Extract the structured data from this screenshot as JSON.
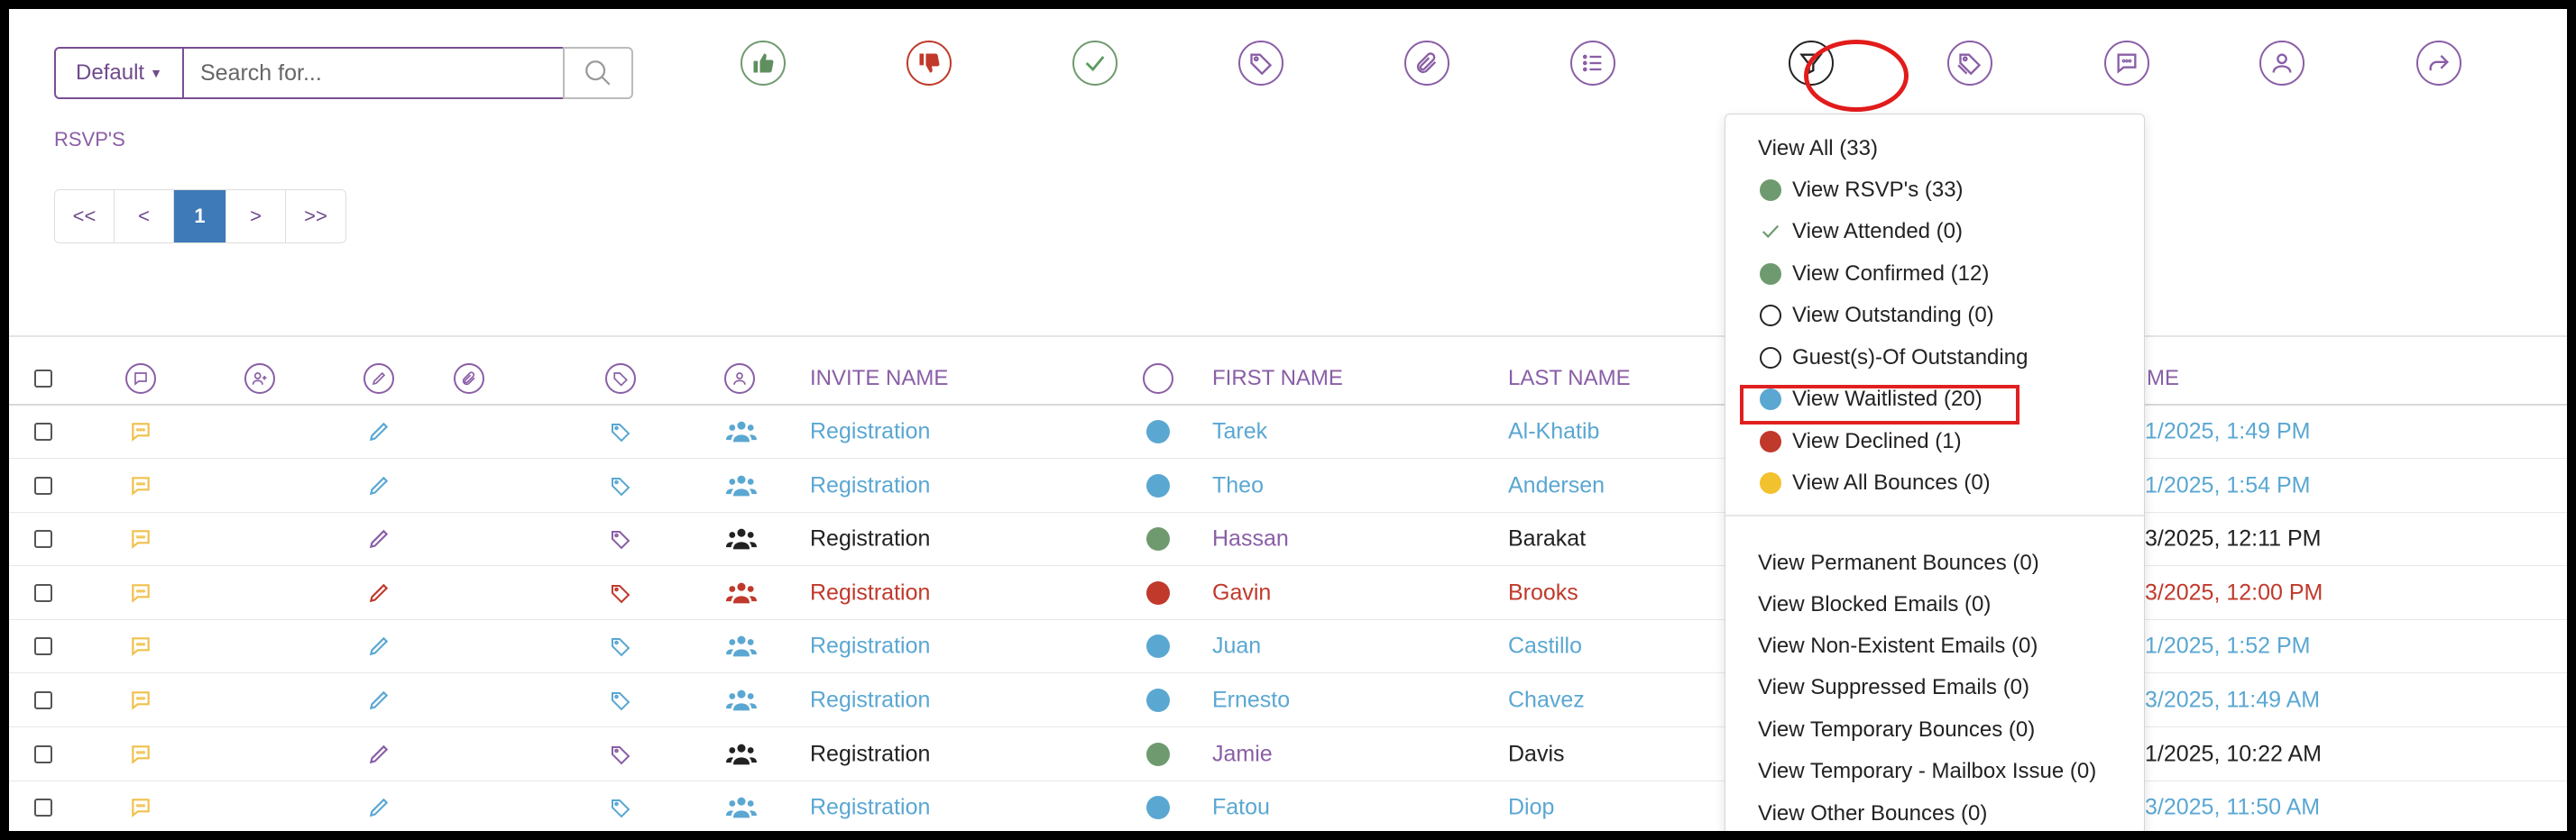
{
  "toolbar": {
    "default_label": "Default",
    "search_placeholder": "Search for...",
    "icons": [
      "thumbs-up-icon",
      "thumbs-down-icon",
      "check-icon",
      "tag-icon",
      "paperclip-icon",
      "list-icon",
      "filter-icon",
      "tags-icon",
      "message-icon",
      "user-icon",
      "share-icon"
    ]
  },
  "section_label": "RSVP'S",
  "pager": {
    "first": "<<",
    "prev": "<",
    "current": "1",
    "next": ">",
    "last": ">>"
  },
  "table": {
    "headers": {
      "invite_name": "INVITE NAME",
      "first_name": "FIRST NAME",
      "last_name": "LAST NAME",
      "time_partial": "ME"
    },
    "rows": [
      {
        "invite": "Registration",
        "first": "Tarek",
        "last": "Al-Khatib",
        "time": "1/2025, 1:49 PM",
        "status": "waitlisted"
      },
      {
        "invite": "Registration",
        "first": "Theo",
        "last": "Andersen",
        "time": "1/2025, 1:54 PM",
        "status": "waitlisted"
      },
      {
        "invite": "Registration",
        "first": "Hassan",
        "last": "Barakat",
        "time": "3/2025, 12:11 PM",
        "status": "confirmed"
      },
      {
        "invite": "Registration",
        "first": "Gavin",
        "last": "Brooks",
        "time": "3/2025, 12:00 PM",
        "status": "declined"
      },
      {
        "invite": "Registration",
        "first": "Juan",
        "last": "Castillo",
        "time": "1/2025, 1:52 PM",
        "status": "waitlisted"
      },
      {
        "invite": "Registration",
        "first": "Ernesto",
        "last": "Chavez",
        "time": "3/2025, 11:49 AM",
        "status": "waitlisted"
      },
      {
        "invite": "Registration",
        "first": "Jamie",
        "last": "Davis",
        "time": "1/2025, 10:22 AM",
        "status": "confirmed"
      },
      {
        "invite": "Registration",
        "first": "Fatou",
        "last": "Diop",
        "time": "3/2025, 11:50 AM",
        "status": "waitlisted"
      }
    ]
  },
  "colors": {
    "purple": "#8a5ea6",
    "waitlisted": "#5aa7d2",
    "confirmed": "#6f9a6f",
    "declined": "#c0392b",
    "bounce": "#f2c12e",
    "note": "#f0c04a",
    "accent_ring": "#e21b1b"
  },
  "filter_menu": {
    "items": [
      {
        "label": "View All (33)",
        "marker": "none"
      },
      {
        "label": "View RSVP's (33)",
        "marker": "green-dot"
      },
      {
        "label": "View Attended (0)",
        "marker": "check"
      },
      {
        "label": "View Confirmed (12)",
        "marker": "green-dot"
      },
      {
        "label": "View Outstanding (0)",
        "marker": "hollow"
      },
      {
        "label": "Guest(s)-Of Outstanding",
        "marker": "hollow"
      },
      {
        "label": "View Waitlisted (20)",
        "marker": "blue-dot"
      },
      {
        "label": "View Declined (1)",
        "marker": "red-dot"
      },
      {
        "label": "View All Bounces (0)",
        "marker": "yellow-dot"
      },
      {
        "label": "View Permanent Bounces (0)",
        "marker": "none"
      },
      {
        "label": "View Blocked Emails (0)",
        "marker": "none"
      },
      {
        "label": "View Non-Existent Emails (0)",
        "marker": "none"
      },
      {
        "label": "View Suppressed Emails (0)",
        "marker": "none"
      },
      {
        "label": "View Temporary Bounces (0)",
        "marker": "none"
      },
      {
        "label": "View Temporary - Mailbox Issue (0)",
        "marker": "none"
      },
      {
        "label": "View Other Bounces (0)",
        "marker": "none"
      }
    ]
  }
}
